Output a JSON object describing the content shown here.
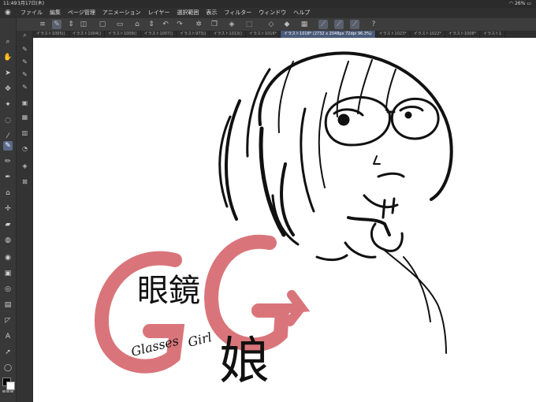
{
  "status": {
    "time": "11:49",
    "date": "3月17日(木)",
    "battery": "26%"
  },
  "menu": {
    "items": [
      "ファイル",
      "編集",
      "ページ管理",
      "アニメーション",
      "レイヤー",
      "選択範囲",
      "表示",
      "フィルター",
      "ウィンドウ",
      "ヘルプ"
    ]
  },
  "tabs": [
    {
      "label": "イラスト1005()"
    },
    {
      "label": "イラスト1004()"
    },
    {
      "label": "イラスト1009()"
    },
    {
      "label": "イラスト1007()"
    },
    {
      "label": "イラスト973()"
    },
    {
      "label": "イラスト1013()"
    },
    {
      "label": "イラスト1016*"
    },
    {
      "label": "イラスト1018* (2732 x 2048px 72dpi 96.3%)",
      "active": true
    },
    {
      "label": "イラスト1023*"
    },
    {
      "label": "イラスト1022*"
    },
    {
      "label": "イラスト1008*"
    },
    {
      "label": "イラスト1"
    }
  ],
  "artwork": {
    "big_letters": "GG",
    "title_line1": "眼鏡",
    "title_line2": "娘",
    "script_line1": "Glasses",
    "script_line2": "Girl",
    "accent_color": "#d9757a"
  },
  "colors": {
    "fg": "#000000",
    "bg": "#ffffff"
  }
}
